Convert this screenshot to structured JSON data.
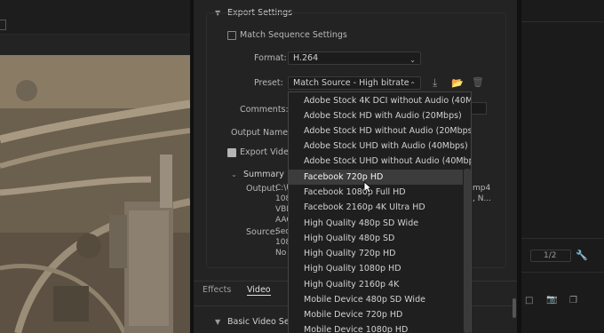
{
  "export_settings": {
    "section_title": "Export Settings",
    "match_sequence_label": "Match Sequence Settings",
    "format_label": "Format:",
    "format_value": "H.264",
    "preset_label": "Preset:",
    "preset_value": "Match Source - High bitrate",
    "comments_label": "Comments:",
    "output_name_label": "Output Name:",
    "export_video_label": "Export Video"
  },
  "summary": {
    "title": "Summary",
    "output_label": "Output:",
    "output_lines": [
      "C:\\U",
      "108",
      "VBR",
      "AAC"
    ],
    "output_right": [
      "mp4",
      ", N..."
    ],
    "source_label": "Source:",
    "source_lines": [
      "Seq",
      "108",
      "No"
    ]
  },
  "tabs": {
    "effects": "Effects",
    "video": "Video"
  },
  "basic_video_settings": "Basic Video Setti",
  "preset_options": [
    "Adobe Stock 4K DCI without Audio (40Mbps)",
    "Adobe Stock HD with Audio (20Mbps)",
    "Adobe Stock HD without Audio (20Mbps)",
    "Adobe Stock UHD with Audio (40Mbps)",
    "Adobe Stock UHD without Audio (40Mbps)",
    "Facebook 720p HD",
    "Facebook 1080p Full HD",
    "Facebook 2160p 4K Ultra HD",
    "High Quality 480p SD Wide",
    "High Quality 480p SD",
    "High Quality 720p HD",
    "High Quality 1080p HD",
    "High Quality 2160p 4K",
    "Mobile Device 480p SD Wide",
    "Mobile Device 720p HD",
    "Mobile Device 1080p HD"
  ],
  "highlighted_option": "Facebook 720p HD",
  "right_panel": {
    "zoom_value": "1/2"
  },
  "colors": {
    "panel_bg": "#232323",
    "highlight": "#3c3c3c",
    "list_bg": "#1f1f1f"
  }
}
